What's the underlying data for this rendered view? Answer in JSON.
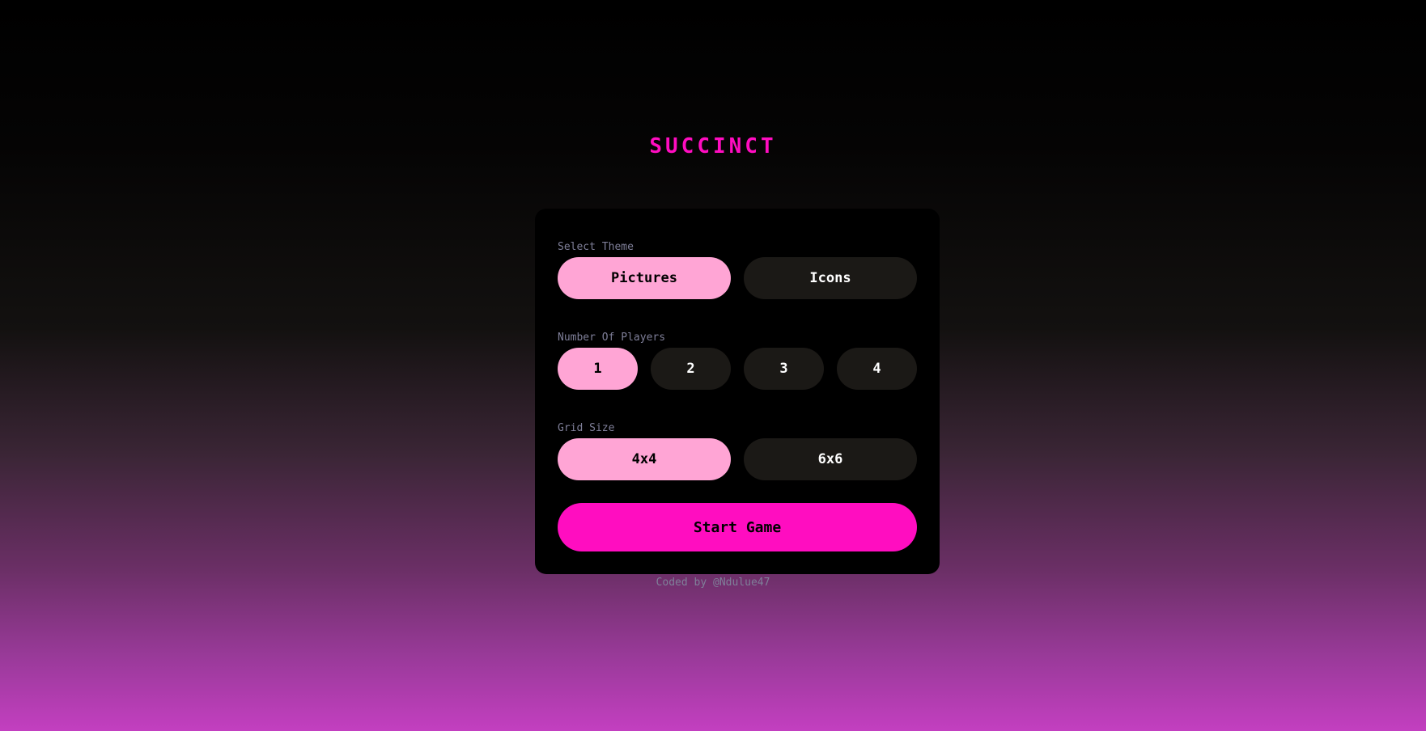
{
  "app": {
    "title": "SUCCINCT"
  },
  "settings": {
    "theme": {
      "label": "Select Theme",
      "options": [
        "Pictures",
        "Icons"
      ],
      "selected": "Pictures"
    },
    "players": {
      "label": "Number Of Players",
      "options": [
        "1",
        "2",
        "3",
        "4"
      ],
      "selected": "1"
    },
    "grid": {
      "label": "Grid Size",
      "options": [
        "4x4",
        "6x6"
      ],
      "selected": "4x4"
    },
    "start_label": "Start Game"
  },
  "footer": {
    "credit": "Coded by @Ndulue47"
  },
  "colors": {
    "accent": "#ff0dc0",
    "selected": "#ffa5d5",
    "unselected": "#1b1916",
    "label": "#7f7f99",
    "card": "#000000"
  }
}
